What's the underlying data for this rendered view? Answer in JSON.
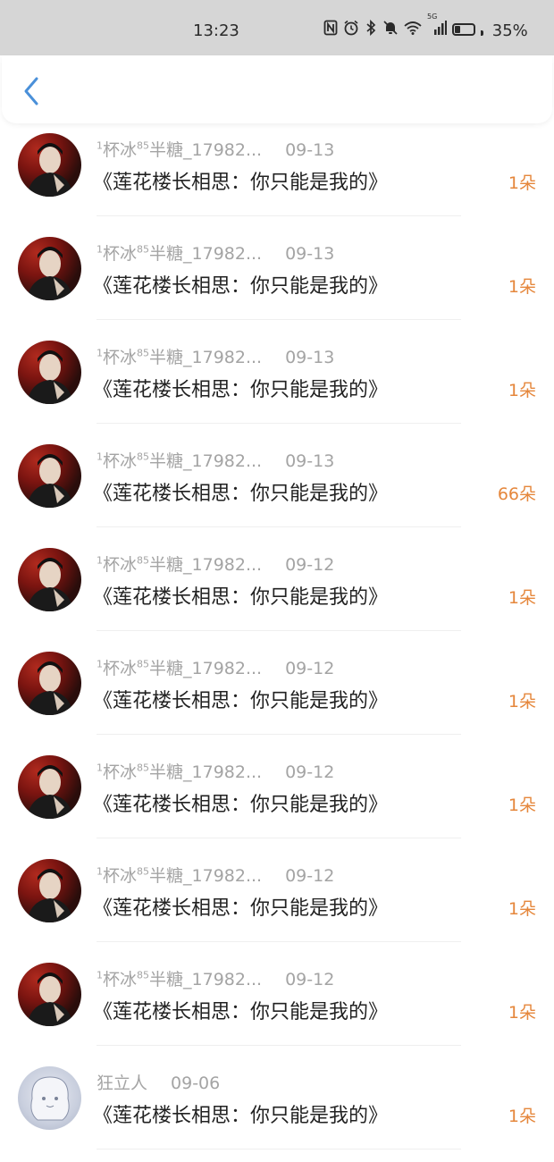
{
  "status_bar": {
    "time": "13:23",
    "network_label": "5G",
    "battery_percent": "35%",
    "battery_level": 0.35
  },
  "header": {
    "back_icon": "chevron-left-icon",
    "accent_color": "#4a90d9"
  },
  "rows": [
    {
      "user": "1杯冰85半糖_17982...",
      "user_prefix": "1",
      "user_main": "杯冰",
      "user_sup": "85",
      "user_rest": "半糖_17982...",
      "date": "09-13",
      "title": "《莲花楼长相思：你只能是我的》",
      "count": "1朵",
      "avatar": "dark"
    },
    {
      "user": "1杯冰85半糖_17982...",
      "user_prefix": "1",
      "user_main": "杯冰",
      "user_sup": "85",
      "user_rest": "半糖_17982...",
      "date": "09-13",
      "title": "《莲花楼长相思：你只能是我的》",
      "count": "1朵",
      "avatar": "dark"
    },
    {
      "user": "1杯冰85半糖_17982...",
      "user_prefix": "1",
      "user_main": "杯冰",
      "user_sup": "85",
      "user_rest": "半糖_17982...",
      "date": "09-13",
      "title": "《莲花楼长相思：你只能是我的》",
      "count": "1朵",
      "avatar": "dark"
    },
    {
      "user": "1杯冰85半糖_17982...",
      "user_prefix": "1",
      "user_main": "杯冰",
      "user_sup": "85",
      "user_rest": "半糖_17982...",
      "date": "09-13",
      "title": "《莲花楼长相思：你只能是我的》",
      "count": "66朵",
      "avatar": "dark"
    },
    {
      "user": "1杯冰85半糖_17982...",
      "user_prefix": "1",
      "user_main": "杯冰",
      "user_sup": "85",
      "user_rest": "半糖_17982...",
      "date": "09-12",
      "title": "《莲花楼长相思：你只能是我的》",
      "count": "1朵",
      "avatar": "dark"
    },
    {
      "user": "1杯冰85半糖_17982...",
      "user_prefix": "1",
      "user_main": "杯冰",
      "user_sup": "85",
      "user_rest": "半糖_17982...",
      "date": "09-12",
      "title": "《莲花楼长相思：你只能是我的》",
      "count": "1朵",
      "avatar": "dark"
    },
    {
      "user": "1杯冰85半糖_17982...",
      "user_prefix": "1",
      "user_main": "杯冰",
      "user_sup": "85",
      "user_rest": "半糖_17982...",
      "date": "09-12",
      "title": "《莲花楼长相思：你只能是我的》",
      "count": "1朵",
      "avatar": "dark"
    },
    {
      "user": "1杯冰85半糖_17982...",
      "user_prefix": "1",
      "user_main": "杯冰",
      "user_sup": "85",
      "user_rest": "半糖_17982...",
      "date": "09-12",
      "title": "《莲花楼长相思：你只能是我的》",
      "count": "1朵",
      "avatar": "dark"
    },
    {
      "user": "1杯冰85半糖_17982...",
      "user_prefix": "1",
      "user_main": "杯冰",
      "user_sup": "85",
      "user_rest": "半糖_17982...",
      "date": "09-12",
      "title": "《莲花楼长相思：你只能是我的》",
      "count": "1朵",
      "avatar": "dark"
    },
    {
      "user": "狂立人",
      "user_prefix": "",
      "user_main": "狂立人",
      "user_sup": "",
      "user_rest": "",
      "date": "09-06",
      "title": "《莲花楼长相思：你只能是我的》",
      "count": "1朵",
      "avatar": "light"
    }
  ]
}
